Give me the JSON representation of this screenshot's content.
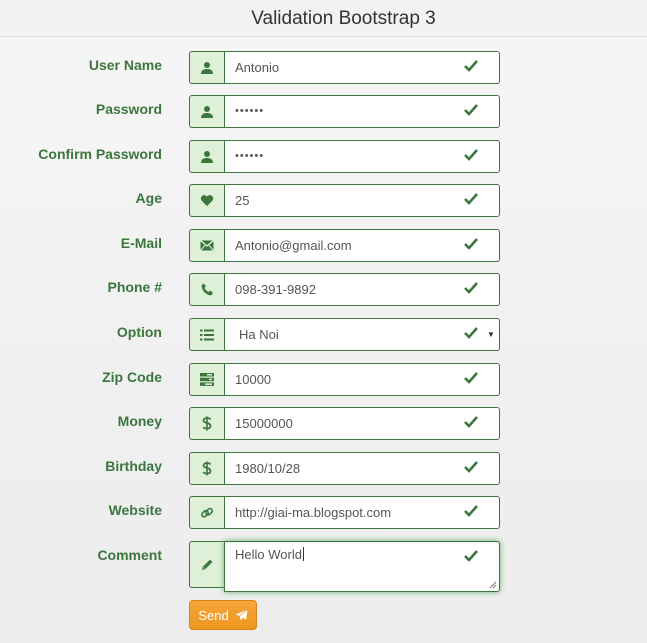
{
  "page": {
    "title": "Validation Bootstrap 3"
  },
  "form": {
    "fields": [
      {
        "label": "User Name",
        "value": "Antonio",
        "icon": "user-icon"
      },
      {
        "label": "Password",
        "value": "••••••",
        "icon": "user-icon"
      },
      {
        "label": "Confirm Password",
        "value": "••••••",
        "icon": "user-icon"
      },
      {
        "label": "Age",
        "value": "25",
        "icon": "heart-icon"
      },
      {
        "label": "E-Mail",
        "value": "Antonio@gmail.com",
        "icon": "envelope-icon"
      },
      {
        "label": "Phone #",
        "value": "098-391-9892",
        "icon": "phone-icon"
      },
      {
        "label": "Option",
        "value": "Ha Noi",
        "icon": "list-icon"
      },
      {
        "label": "Zip Code",
        "value": "10000",
        "icon": "tasks-icon"
      },
      {
        "label": "Money",
        "value": "15000000",
        "icon": "dollar-icon"
      },
      {
        "label": "Birthday",
        "value": "1980/10/28",
        "icon": "dollar-icon"
      },
      {
        "label": "Website",
        "value": "http://giai-ma.blogspot.com",
        "icon": "link-icon"
      },
      {
        "label": "Comment",
        "value": "Hello World",
        "icon": "pencil-icon"
      }
    ],
    "submit_label": "Send"
  },
  "colors": {
    "success_text": "#3c763d",
    "success_bg": "#dff0d8",
    "button": "#f0ad4e"
  }
}
